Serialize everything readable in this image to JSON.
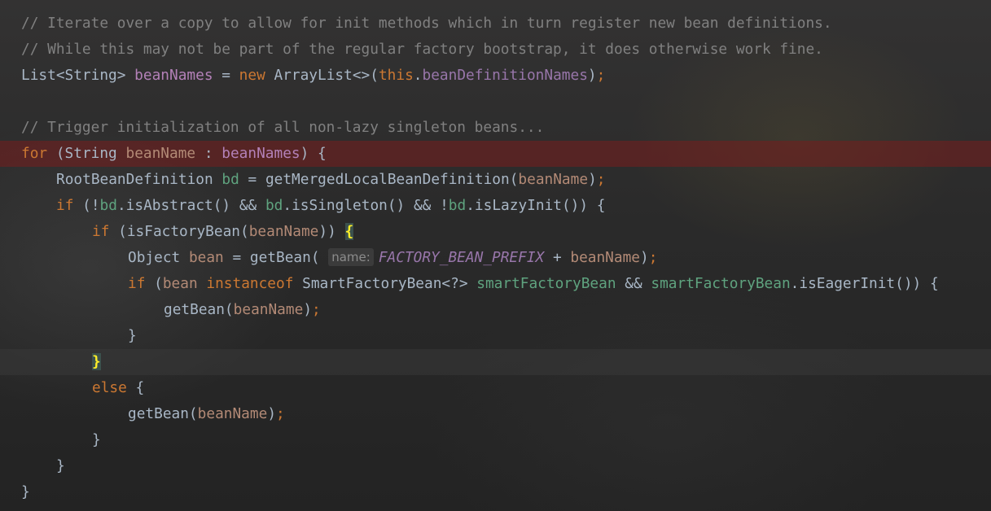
{
  "editor": {
    "lines": [
      {
        "t": [
          {
            "c": "comment",
            "s": "// Iterate over a copy to allow for init methods which in turn register new bean definitions."
          }
        ]
      },
      {
        "t": [
          {
            "c": "comment",
            "s": "// While this may not be part of the regular factory bootstrap, it does otherwise work fine."
          }
        ]
      },
      {
        "t": [
          {
            "c": "plain",
            "s": "List<String> "
          },
          {
            "c": "local",
            "s": "beanNames"
          },
          {
            "c": "plain",
            "s": " = "
          },
          {
            "c": "keyword",
            "s": "new "
          },
          {
            "c": "plain",
            "s": "ArrayList<>("
          },
          {
            "c": "keyword",
            "s": "this"
          },
          {
            "c": "plain",
            "s": "."
          },
          {
            "c": "field",
            "s": "beanDefinitionNames"
          },
          {
            "c": "plain",
            "s": ")"
          },
          {
            "c": "punct",
            "s": ";"
          }
        ]
      },
      {
        "t": []
      },
      {
        "t": [
          {
            "c": "comment",
            "s": "// Trigger initialization of all non-lazy singleton beans..."
          }
        ]
      },
      {
        "hl": "breakpoint",
        "t": [
          {
            "c": "keyword",
            "s": "for "
          },
          {
            "c": "plain",
            "s": "(String "
          },
          {
            "c": "param",
            "s": "beanName"
          },
          {
            "c": "plain",
            "s": " : "
          },
          {
            "c": "local",
            "s": "beanNames"
          },
          {
            "c": "plain",
            "s": ") {"
          }
        ]
      },
      {
        "indent": 1,
        "t": [
          {
            "c": "plain",
            "s": "RootBeanDefinition "
          },
          {
            "c": "patvar",
            "s": "bd"
          },
          {
            "c": "plain",
            "s": " = getMergedLocalBeanDefinition("
          },
          {
            "c": "param",
            "s": "beanName"
          },
          {
            "c": "plain",
            "s": ")"
          },
          {
            "c": "punct",
            "s": ";"
          }
        ]
      },
      {
        "indent": 1,
        "t": [
          {
            "c": "keyword",
            "s": "if "
          },
          {
            "c": "plain",
            "s": "(!"
          },
          {
            "c": "patvar",
            "s": "bd"
          },
          {
            "c": "plain",
            "s": ".isAbstract() && "
          },
          {
            "c": "patvar",
            "s": "bd"
          },
          {
            "c": "plain",
            "s": ".isSingleton() && !"
          },
          {
            "c": "patvar",
            "s": "bd"
          },
          {
            "c": "plain",
            "s": ".isLazyInit()) {"
          }
        ]
      },
      {
        "indent": 2,
        "t": [
          {
            "c": "keyword",
            "s": "if "
          },
          {
            "c": "plain",
            "s": "(isFactoryBean("
          },
          {
            "c": "param",
            "s": "beanName"
          },
          {
            "c": "plain",
            "s": ")) "
          },
          {
            "c": "brace",
            "s": "{"
          }
        ]
      },
      {
        "indent": 3,
        "t": [
          {
            "c": "plain",
            "s": "Object "
          },
          {
            "c": "param",
            "s": "bean"
          },
          {
            "c": "plain",
            "s": " = getBean( "
          },
          {
            "c": "hint",
            "s": "name:"
          },
          {
            "c": "static",
            "s": "FACTORY_BEAN_PREFIX"
          },
          {
            "c": "plain",
            "s": " + "
          },
          {
            "c": "param",
            "s": "beanName"
          },
          {
            "c": "plain",
            "s": ")"
          },
          {
            "c": "punct",
            "s": ";"
          }
        ]
      },
      {
        "indent": 3,
        "t": [
          {
            "c": "keyword",
            "s": "if "
          },
          {
            "c": "plain",
            "s": "("
          },
          {
            "c": "param",
            "s": "bean "
          },
          {
            "c": "keyword",
            "s": "instanceof "
          },
          {
            "c": "plain",
            "s": "SmartFactoryBean<?> "
          },
          {
            "c": "patvar",
            "s": "smartFactoryBean"
          },
          {
            "c": "plain",
            "s": " && "
          },
          {
            "c": "patvar",
            "s": "smartFactoryBean"
          },
          {
            "c": "plain",
            "s": ".isEagerInit()) {"
          }
        ]
      },
      {
        "indent": 4,
        "t": [
          {
            "c": "plain",
            "s": "getBean("
          },
          {
            "c": "param",
            "s": "beanName"
          },
          {
            "c": "plain",
            "s": ")"
          },
          {
            "c": "punct",
            "s": ";"
          }
        ]
      },
      {
        "indent": 3,
        "t": [
          {
            "c": "plain",
            "s": "}"
          }
        ]
      },
      {
        "hl": "caret",
        "indent": 2,
        "t": [
          {
            "c": "brace",
            "s": "}"
          }
        ]
      },
      {
        "indent": 2,
        "t": [
          {
            "c": "keyword",
            "s": "else "
          },
          {
            "c": "plain",
            "s": "{"
          }
        ]
      },
      {
        "indent": 3,
        "t": [
          {
            "c": "plain",
            "s": "getBean("
          },
          {
            "c": "param",
            "s": "beanName"
          },
          {
            "c": "plain",
            "s": ")"
          },
          {
            "c": "punct",
            "s": ";"
          }
        ]
      },
      {
        "indent": 2,
        "t": [
          {
            "c": "plain",
            "s": "}"
          }
        ]
      },
      {
        "indent": 1,
        "t": [
          {
            "c": "plain",
            "s": "}"
          }
        ]
      },
      {
        "t": [
          {
            "c": "plain",
            "s": "}"
          }
        ]
      }
    ]
  },
  "colors": {
    "comment": "#808080",
    "keyword": "#cc7832",
    "field": "#9876aa",
    "local": "#b381b8",
    "param": "#b38a76",
    "pattern_variable": "#5fa37f",
    "plain": "#a9b7c6",
    "brace_match": "#ffef28",
    "breakpoint_line": "#5a2222"
  }
}
